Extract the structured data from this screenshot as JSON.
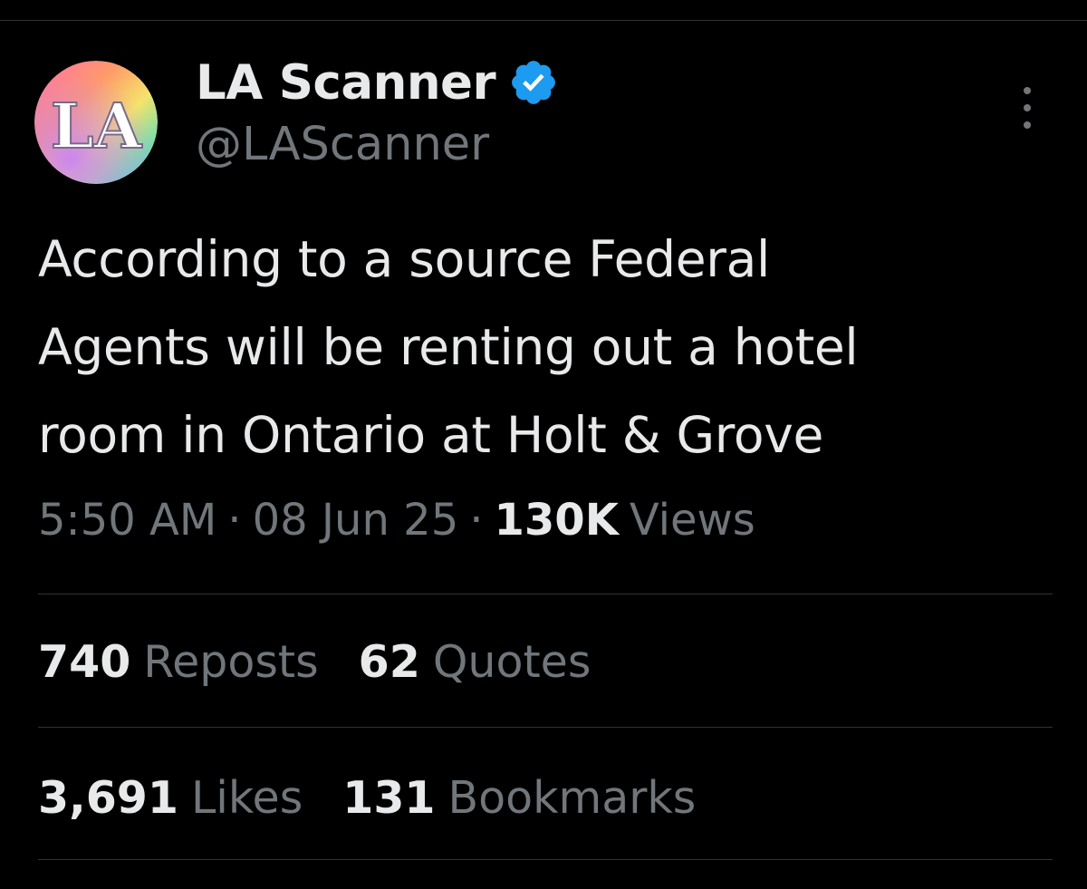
{
  "author": {
    "display_name": "LA Scanner",
    "handle": "@LAScanner",
    "verified": true,
    "avatar_monogram": "LA",
    "verified_color": "#1d9bf0"
  },
  "tweet": {
    "text_lines": [
      "According to a source Federal",
      "Agents will be renting out a hotel",
      "room in Ontario at Holt & Grove"
    ]
  },
  "meta": {
    "time": "5:50 AM",
    "separator": "·",
    "date": "08 Jun 25",
    "views_count": "130K",
    "views_label": "Views"
  },
  "stats": {
    "row1": [
      {
        "count": "740",
        "label": "Reposts"
      },
      {
        "count": "62",
        "label": "Quotes"
      }
    ],
    "row2": [
      {
        "count": "3,691",
        "label": "Likes"
      },
      {
        "count": "131",
        "label": "Bookmarks"
      }
    ]
  },
  "icons": {
    "more": "more-vertical-icon",
    "verified": "verified-badge-icon"
  },
  "colors": {
    "background": "#000000",
    "primary_text": "#e7e9ea",
    "secondary_text": "#71767b",
    "divider": "#2f3336"
  }
}
